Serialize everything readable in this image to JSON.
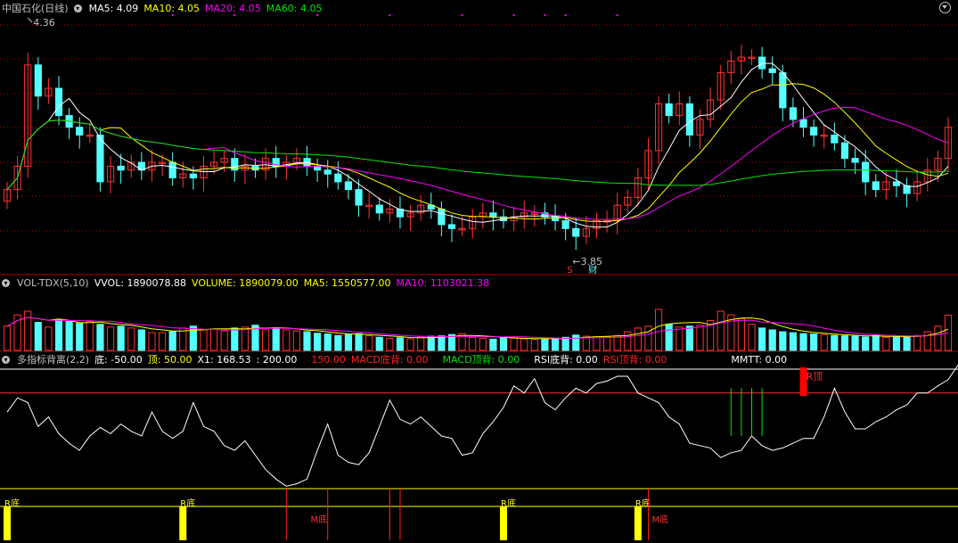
{
  "price_panel": {
    "stock_name": "中国石化(日线)",
    "ma5_label": "MA5: 4.09",
    "ma10_label": "MA10: 4.05",
    "ma20_label": "MA20: 4.05",
    "ma60_label": "MA60: 4.05",
    "high_annotation": "4.36",
    "low_annotation": "3.85",
    "marker_s": "S",
    "marker_cai": "财"
  },
  "volume_panel": {
    "name": "VOL-TDX(5,10)",
    "vvol_label": "VVOL: 1890078.88",
    "volume_label": "VOLUME: 1890079.00",
    "ma5_label": "MA5: 1550577.00",
    "ma10_label": "MA10: 1103021.38"
  },
  "indicator_panel": {
    "name": "多指标背离(2,2)",
    "bottom_label": "底: -50.00",
    "top_label": "顶: 50.00",
    "x1_label": "X1: 168.53",
    "level_200": ": 200.00",
    "level_150": "150.00",
    "macd_bottom": "MACD底背: 0.00",
    "macd_top": "MACD顶背: 0.00",
    "rsi_bottom": "RSI底背: 0.00",
    "rsi_top": "RSI顶背: 0.00",
    "mmtt": "MMTT: 0.00",
    "r_top_marker": "R顶",
    "r_bottom_marker": "R底",
    "m_bottom_marker": "M底"
  },
  "colors": {
    "up": "#ff3232",
    "down": "#54ffff",
    "ma5": "#ffffff",
    "ma10": "#ffff00",
    "ma20": "#ff00ff",
    "ma60": "#00e600",
    "grid": "#b00000"
  },
  "chart_data": {
    "type": "candlestick",
    "price_axis_range": [
      3.8,
      4.45
    ],
    "close": [
      4.0,
      4.06,
      4.32,
      4.24,
      4.26,
      4.19,
      4.16,
      4.14,
      4.14,
      4.02,
      4.06,
      4.05,
      4.07,
      4.05,
      4.07,
      4.07,
      4.03,
      4.04,
      4.03,
      4.06,
      4.07,
      4.08,
      4.05,
      4.06,
      4.05,
      4.08,
      4.06,
      4.07,
      4.08,
      4.06,
      4.05,
      4.04,
      4.02,
      4.0,
      3.96,
      3.96,
      3.94,
      3.95,
      3.93,
      3.94,
      3.96,
      3.95,
      3.91,
      3.9,
      3.9,
      3.93,
      3.94,
      3.93,
      3.92,
      3.93,
      3.94,
      3.94,
      3.93,
      3.92,
      3.9,
      3.88,
      3.9,
      3.92,
      3.92,
      3.96,
      3.98,
      4.03,
      4.1,
      4.22,
      4.19,
      4.22,
      4.14,
      4.18,
      4.23,
      4.3,
      4.33,
      4.34,
      4.34,
      4.31,
      4.3,
      4.21,
      4.18,
      4.16,
      4.14,
      4.14,
      4.12,
      4.08,
      4.07,
      4.02,
      4.0,
      4.02,
      4.01,
      3.99,
      4.02,
      4.05,
      4.08,
      4.16
    ],
    "volume_axis_range": [
      0,
      3200000
    ],
    "volume": [
      1300000,
      1900000,
      2100000,
      1500000,
      1250000,
      1650000,
      1550000,
      1450000,
      1550000,
      1400000,
      1250000,
      1300000,
      1200000,
      1100000,
      950000,
      950000,
      1000000,
      1200000,
      1300000,
      1100000,
      1150000,
      1050000,
      1200000,
      1250000,
      1350000,
      1100000,
      1200000,
      1100000,
      1050000,
      1000000,
      920000,
      880000,
      800000,
      850000,
      900000,
      780000,
      700000,
      650000,
      680000,
      620000,
      720000,
      760000,
      780000,
      850000,
      900000,
      700000,
      650000,
      600000,
      680000,
      700000,
      620000,
      580000,
      600000,
      620000,
      700000,
      820000,
      760000,
      740000,
      720000,
      800000,
      1000000,
      1200000,
      1300000,
      2200000,
      1400000,
      1250000,
      1300000,
      1350000,
      1600000,
      2100000,
      1900000,
      1700000,
      1400000,
      1200000,
      1100000,
      1000000,
      950000,
      900000,
      880000,
      850000,
      800000,
      780000,
      760000,
      720000,
      800000,
      700000,
      760000,
      720000,
      800000,
      1000000,
      1300000,
      1890079
    ],
    "indicator_axis_range": [
      -50,
      200
    ],
    "indicator": [
      110,
      140,
      130,
      80,
      100,
      65,
      45,
      30,
      60,
      78,
      65,
      85,
      70,
      60,
      110,
      70,
      55,
      70,
      130,
      80,
      70,
      40,
      30,
      50,
      20,
      -10,
      -30,
      -45,
      -40,
      -30,
      30,
      85,
      20,
      5,
      0,
      25,
      80,
      135,
      95,
      85,
      100,
      80,
      60,
      55,
      20,
      25,
      65,
      90,
      120,
      165,
      150,
      180,
      130,
      115,
      140,
      160,
      150,
      170,
      175,
      185,
      185,
      150,
      140,
      130,
      100,
      85,
      45,
      40,
      35,
      15,
      25,
      30,
      60,
      40,
      30,
      35,
      45,
      55,
      55,
      100,
      160,
      110,
      75,
      75,
      90,
      100,
      115,
      125,
      150,
      150,
      165,
      178,
      210,
      230
    ],
    "signals": {
      "r_bottom_index": [
        0,
        17,
        48,
        61
      ],
      "m_bottom_index": [
        27,
        31,
        37,
        38,
        62
      ],
      "r_top_index": [
        77
      ],
      "mmtt_index": [
        70,
        71,
        72,
        73
      ]
    }
  }
}
